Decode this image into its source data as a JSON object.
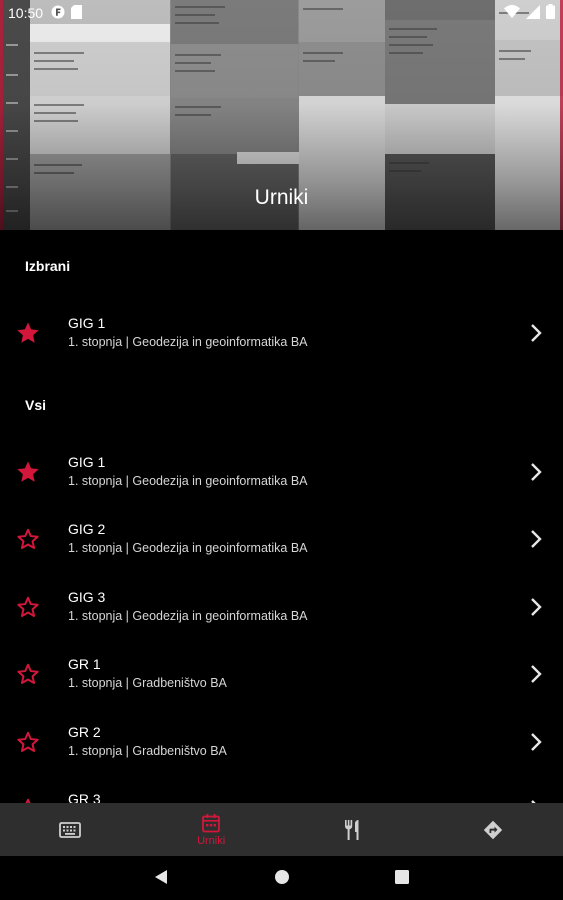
{
  "status_bar": {
    "time": "10:50",
    "icons": [
      "f-app-icon",
      "sd-card-icon",
      "wifi-icon",
      "signal-icon",
      "battery-icon"
    ]
  },
  "header": {
    "title": "Urniki"
  },
  "sections": {
    "favorites_label": "Izbrani",
    "all_label": "Vsi"
  },
  "favorites": [
    {
      "title": "GIG 1",
      "subtitle": "1. stopnja | Geodezija in geoinformatika BA",
      "starred": true
    }
  ],
  "all": [
    {
      "title": "GIG 1",
      "subtitle": "1. stopnja | Geodezija in geoinformatika BA",
      "starred": true
    },
    {
      "title": "GIG 2",
      "subtitle": "1. stopnja | Geodezija in geoinformatika BA",
      "starred": false
    },
    {
      "title": "GIG 3",
      "subtitle": "1. stopnja | Geodezija in geoinformatika BA",
      "starred": false
    },
    {
      "title": "GR 1",
      "subtitle": "1. stopnja | Gradbeništvo BA",
      "starred": false
    },
    {
      "title": "GR 2",
      "subtitle": "1. stopnja | Gradbeništvo BA",
      "starred": false
    },
    {
      "title": "GR 3",
      "subtitle": "",
      "starred": false
    }
  ],
  "bottom_nav": {
    "items": [
      {
        "icon": "keyboard-icon",
        "label": "",
        "active": false
      },
      {
        "icon": "calendar-icon",
        "label": "Urniki",
        "active": true
      },
      {
        "icon": "restaurant-icon",
        "label": "",
        "active": false
      },
      {
        "icon": "directions-icon",
        "label": "",
        "active": false
      }
    ]
  },
  "colors": {
    "accent": "#d3173b",
    "background": "#000000",
    "nav_background": "#2e2e2e",
    "subtitle": "#d6d6d6"
  }
}
